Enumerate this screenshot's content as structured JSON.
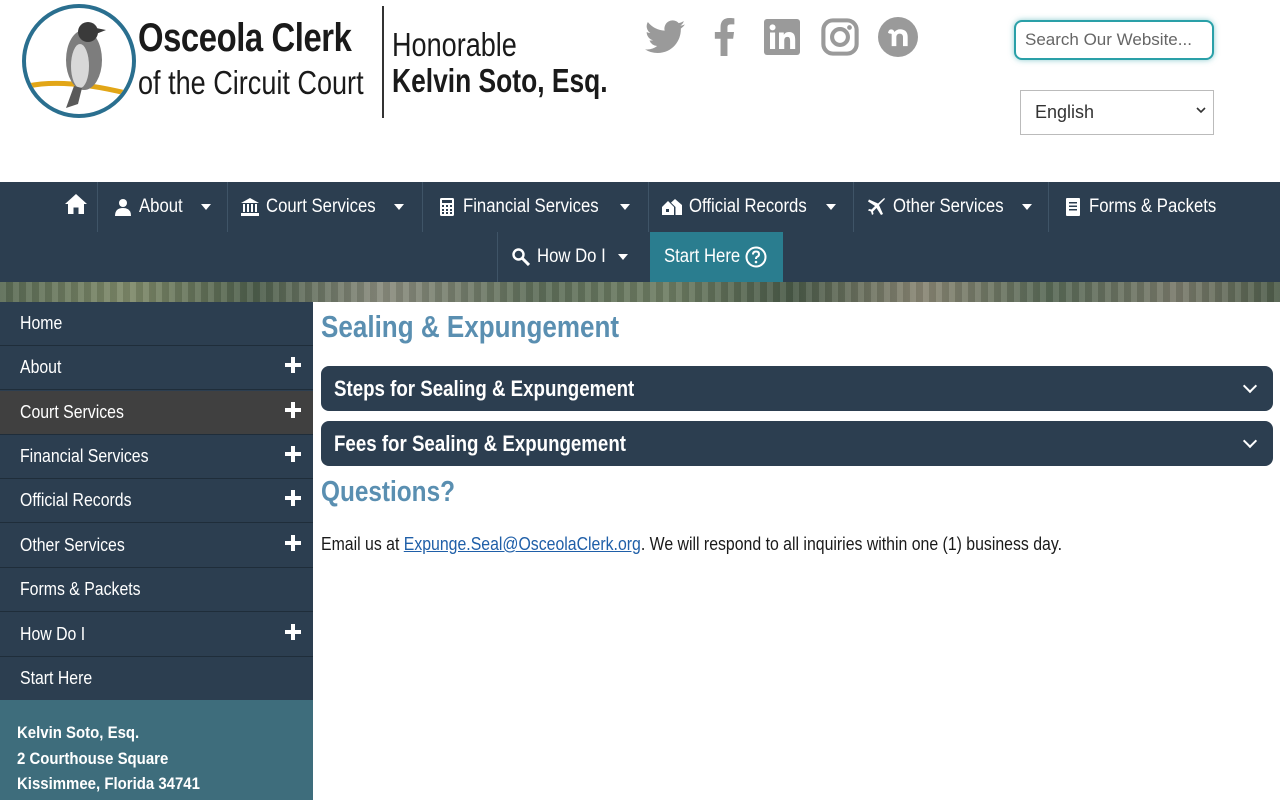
{
  "header": {
    "logo": {
      "title_line1": "Osceola Clerk",
      "title_line2": "of the Circuit Court",
      "honorable": "Honorable",
      "name": "Kelvin Soto, Esq."
    },
    "social": [
      {
        "icon": "twitter-icon",
        "color": "#9a9a9a"
      },
      {
        "icon": "facebook-icon",
        "color": "#9a9a9a"
      },
      {
        "icon": "linkedin-icon",
        "color": "#9a9a9a"
      },
      {
        "icon": "instagram-icon",
        "color": "#9a9a9a"
      },
      {
        "icon": "nextdoor-icon",
        "color": "#9a9a9a"
      }
    ],
    "search": {
      "placeholder": "Search Our Website...",
      "value": ""
    },
    "language": {
      "selected": "English"
    }
  },
  "nav": {
    "items": [
      {
        "label": "About",
        "icon": "user-icon",
        "has_dropdown": true
      },
      {
        "label": "Court Services",
        "icon": "courthouse-icon",
        "has_dropdown": true
      },
      {
        "label": "Financial Services",
        "icon": "calculator-icon",
        "has_dropdown": true
      },
      {
        "label": "Official Records",
        "icon": "houses-icon",
        "has_dropdown": true
      },
      {
        "label": "Other Services",
        "icon": "plane-icon",
        "has_dropdown": true
      },
      {
        "label": "Forms & Packets",
        "icon": "document-icon",
        "has_dropdown": false
      },
      {
        "label": "How Do I",
        "icon": "search-key-icon",
        "has_dropdown": true
      },
      {
        "label": "Start Here",
        "icon": "question-circle-icon",
        "has_dropdown": false
      }
    ],
    "home_icon": "home-icon"
  },
  "sidebar": {
    "items": [
      {
        "label": "Home",
        "expandable": false
      },
      {
        "label": "About",
        "expandable": true
      },
      {
        "label": "Court Services",
        "expandable": true,
        "active": true
      },
      {
        "label": "Financial Services",
        "expandable": true
      },
      {
        "label": "Official Records",
        "expandable": true
      },
      {
        "label": "Other Services",
        "expandable": true
      },
      {
        "label": "Forms & Packets",
        "expandable": false
      },
      {
        "label": "How Do I",
        "expandable": true
      },
      {
        "label": "Start Here",
        "expandable": false
      }
    ],
    "address": {
      "name": "Kelvin Soto, Esq.",
      "street": "2 Courthouse Square",
      "city": "Kissimmee, Florida 34741"
    }
  },
  "main": {
    "title": "Sealing & Expungement",
    "accordions": [
      {
        "label": "Steps for Sealing & Expungement"
      },
      {
        "label": "Fees for Sealing & Expungement"
      }
    ],
    "questions_title": "Questions?",
    "email_prefix": "Email us at ",
    "email": "Expunge.Seal@OsceolaClerk.org",
    "email_suffix": ". We will respond to all inquiries within one (1) business day."
  },
  "colors": {
    "nav_bg": "#2c3e50",
    "accent_teal": "#2a7d8f",
    "title_blue": "#5a8fb1",
    "link_blue": "#1f5fa8",
    "sidebar_active": "#404040",
    "address_bg": "#3e6d7c"
  }
}
